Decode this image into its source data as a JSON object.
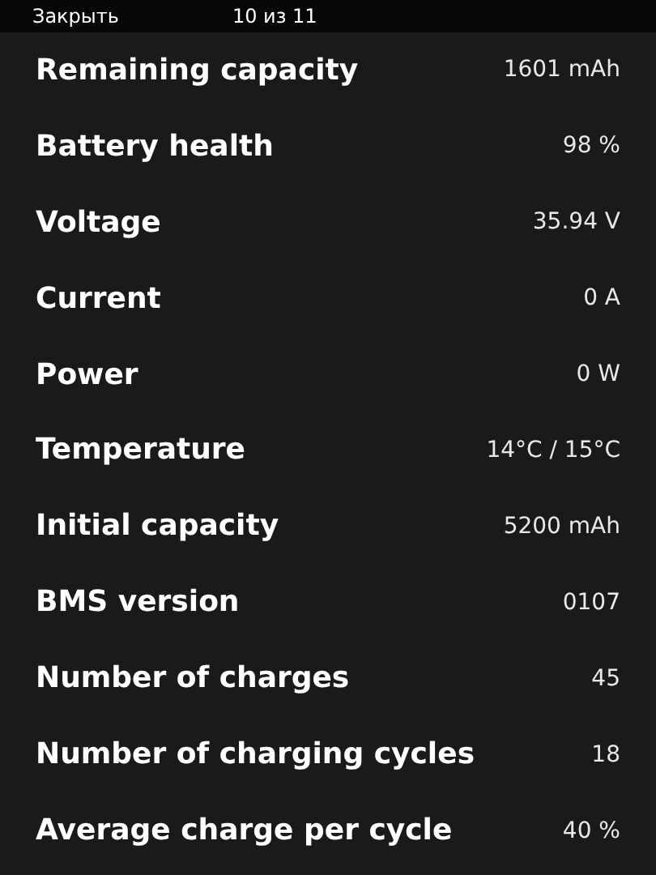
{
  "top_bar": {
    "close": "Закрыть",
    "counter": "10 из 11"
  },
  "rows": [
    {
      "label": "Remaining capacity",
      "value": "1601 mAh"
    },
    {
      "label": "Battery health",
      "value": "98 %"
    },
    {
      "label": "Voltage",
      "value": "35.94 V"
    },
    {
      "label": "Current",
      "value": "0 A"
    },
    {
      "label": "Power",
      "value": "0 W"
    },
    {
      "label": "Temperature",
      "value": "14°C / 15°C"
    },
    {
      "label": "Initial capacity",
      "value": "5200 mAh"
    },
    {
      "label": "BMS version",
      "value": "0107"
    },
    {
      "label": "Number of charges",
      "value": "45"
    },
    {
      "label": "Number of charging cycles",
      "value": "18"
    },
    {
      "label": "Average charge per cycle",
      "value": "40 %"
    }
  ]
}
